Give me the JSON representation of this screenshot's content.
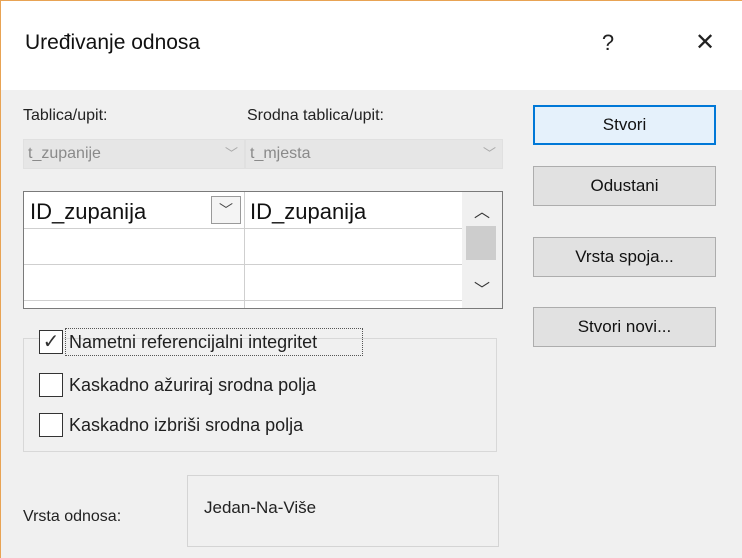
{
  "dialog": {
    "title": "Uređivanje odnosa",
    "help_glyph": "?",
    "close_glyph": "✕"
  },
  "tables": {
    "left_label": "Tablica/upit:",
    "right_label": "Srodna tablica/upit:",
    "left_value": "t_zupanije",
    "right_value": "t_mjesta",
    "dropdown_glyph": "﹀"
  },
  "fields_grid": {
    "rows": [
      {
        "left": "ID_zupanija",
        "right": "ID_zupanija"
      },
      {
        "left": "",
        "right": ""
      },
      {
        "left": "",
        "right": ""
      }
    ],
    "dropdown_glyph": "﹀",
    "scroll_up_glyph": "︿",
    "scroll_down_glyph": "﹀"
  },
  "options": [
    {
      "label": "Nametni referencijalni integritet",
      "checked": true,
      "mark": "✓"
    },
    {
      "label": "Kaskadno ažuriraj srodna polja",
      "checked": false,
      "mark": ""
    },
    {
      "label": "Kaskadno izbriši srodna polja",
      "checked": false,
      "mark": ""
    }
  ],
  "relationship": {
    "label": "Vrsta odnosa:",
    "value": "Jedan-Na-Više"
  },
  "buttons": {
    "create": "Stvori",
    "cancel": "Odustani",
    "join_type": "Vrsta spoja...",
    "create_new": "Stvori novi..."
  },
  "colors": {
    "accent": "#0078d7",
    "window_border": "#e8a354"
  }
}
